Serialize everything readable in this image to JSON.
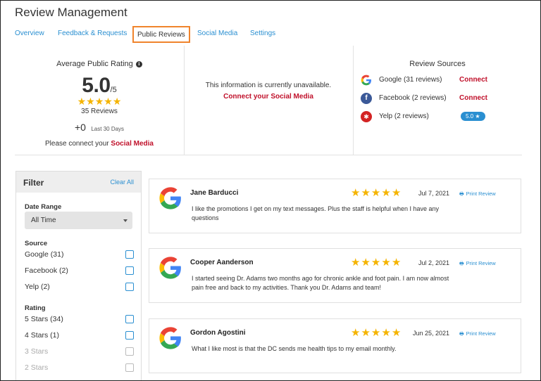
{
  "header": {
    "title": "Review Management"
  },
  "tabs": [
    {
      "label": "Overview"
    },
    {
      "label": "Feedback & Requests"
    },
    {
      "label": "Public Reviews"
    },
    {
      "label": "Social Media"
    },
    {
      "label": "Settings"
    }
  ],
  "average": {
    "title": "Average Public Rating",
    "info_icon": "info-icon",
    "value": "5.0",
    "out_of": "/5",
    "rating_stars": 5,
    "reviews": "35 Reviews",
    "delta": "+0",
    "delta_label": "Last 30 Days",
    "connect_prefix": "Please connect your",
    "connect_link": "Social Media"
  },
  "unavailable": {
    "message": "This information is currently unavailable.",
    "link": "Connect your Social Media"
  },
  "sources": {
    "title": "Review Sources",
    "items": [
      {
        "icon": "google-icon",
        "label": "Google (31 reviews)",
        "action": "Connect"
      },
      {
        "icon": "facebook-icon",
        "label": "Facebook (2 reviews)",
        "action": "Connect"
      },
      {
        "icon": "yelp-icon",
        "label": "Yelp (2 reviews)",
        "badge": "5.0 ★"
      }
    ]
  },
  "filter": {
    "title": "Filter",
    "clear_all": "Clear All",
    "date_range": {
      "label": "Date Range",
      "selected": "All Time"
    },
    "source": {
      "label": "Source",
      "options": [
        {
          "label": "Google (31)",
          "checked": false
        },
        {
          "label": "Facebook (2)",
          "checked": false
        },
        {
          "label": "Yelp (2)",
          "checked": false
        }
      ]
    },
    "rating": {
      "label": "Rating",
      "options": [
        {
          "label": "5 Stars (34)",
          "checked": false
        },
        {
          "label": "4 Stars (1)",
          "checked": false
        },
        {
          "label": "3 Stars",
          "checked": false
        },
        {
          "label": "2 Stars",
          "checked": false
        }
      ]
    }
  },
  "reviews": [
    {
      "name": "Jane Barducci",
      "stars": 5,
      "date": "Jul 7, 2021",
      "print": "Print Review",
      "text": "I like the promotions I get on my text messages. Plus the staff is helpful when I have any questions"
    },
    {
      "name": "Cooper Aanderson",
      "stars": 5,
      "date": "Jul 2, 2021",
      "print": "Print Review",
      "text": "I started seeing Dr. Adams two months ago for chronic ankle and foot pain. I am now almost pain free and back to my activities. Thank you Dr. Adams and team!"
    },
    {
      "name": "Gordon Agostini",
      "stars": 5,
      "date": "Jun 25, 2021",
      "print": "Print Review",
      "text": "What I like most is that the DC sends me health tips to my email monthly."
    }
  ],
  "colors": {
    "accent": "#2a8fd1",
    "connect": "#c0102a",
    "active_tab_border": "#f0842c",
    "star": "#f5b400"
  }
}
